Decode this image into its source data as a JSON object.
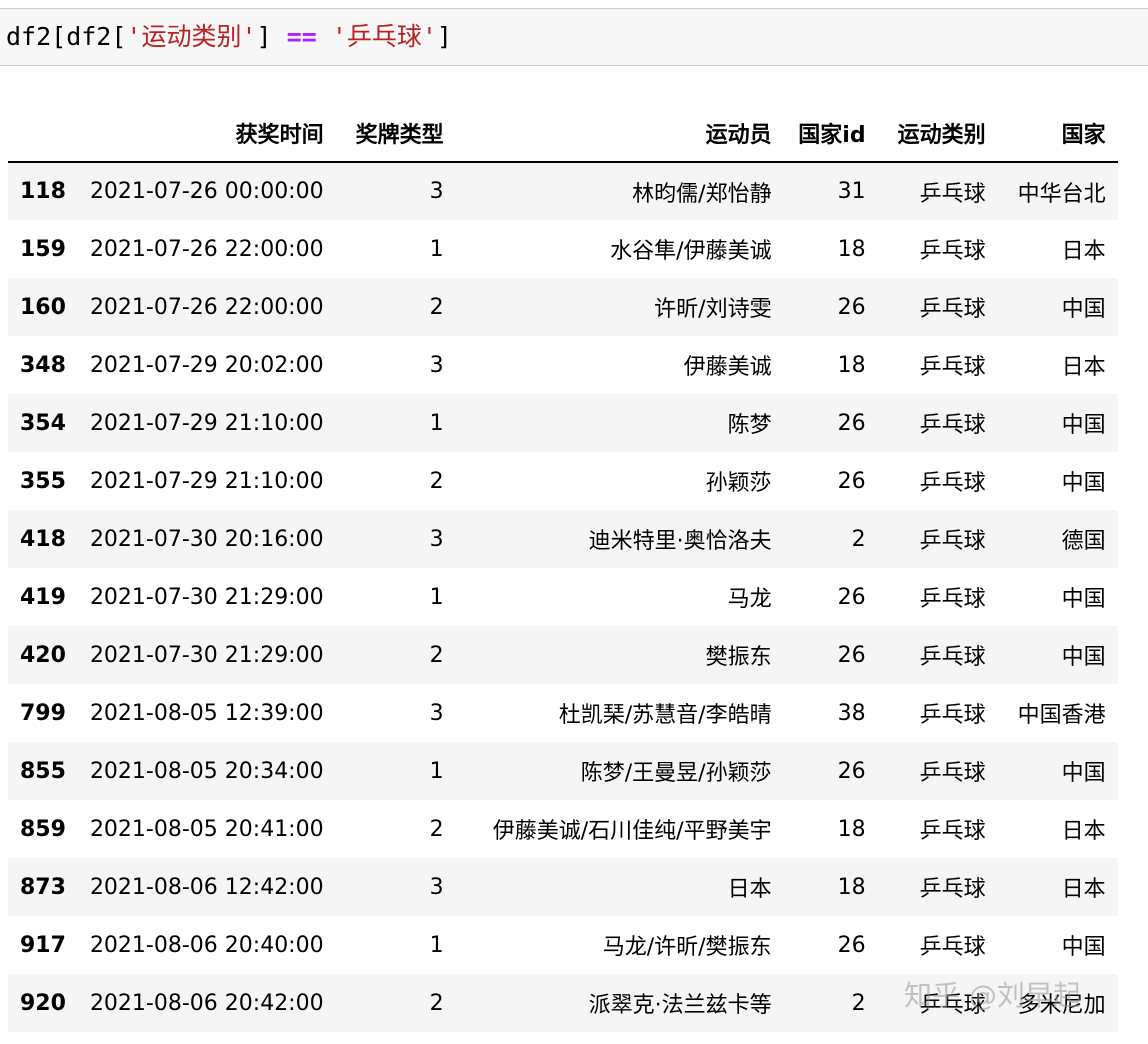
{
  "code_cell": {
    "prefix": "df2[df2[",
    "str1": "'运动类别'",
    "mid": "] ",
    "op": "==",
    "space": " ",
    "str2": "'乒乓球'",
    "suffix": "]"
  },
  "table": {
    "columns": [
      "",
      "获奖时间",
      "奖牌类型",
      "运动员",
      "国家id",
      "运动类别",
      "国家"
    ],
    "rows": [
      {
        "index": "118",
        "time": "2021-07-26 00:00:00",
        "medal": "3",
        "athlete": "林昀儒/郑怡静",
        "country_id": "31",
        "sport": "乒乓球",
        "country": "中华台北"
      },
      {
        "index": "159",
        "time": "2021-07-26 22:00:00",
        "medal": "1",
        "athlete": "水谷隼/伊藤美诚",
        "country_id": "18",
        "sport": "乒乓球",
        "country": "日本"
      },
      {
        "index": "160",
        "time": "2021-07-26 22:00:00",
        "medal": "2",
        "athlete": "许昕/刘诗雯",
        "country_id": "26",
        "sport": "乒乓球",
        "country": "中国"
      },
      {
        "index": "348",
        "time": "2021-07-29 20:02:00",
        "medal": "3",
        "athlete": "伊藤美诚",
        "country_id": "18",
        "sport": "乒乓球",
        "country": "日本"
      },
      {
        "index": "354",
        "time": "2021-07-29 21:10:00",
        "medal": "1",
        "athlete": "陈梦",
        "country_id": "26",
        "sport": "乒乓球",
        "country": "中国"
      },
      {
        "index": "355",
        "time": "2021-07-29 21:10:00",
        "medal": "2",
        "athlete": "孙颖莎",
        "country_id": "26",
        "sport": "乒乓球",
        "country": "中国"
      },
      {
        "index": "418",
        "time": "2021-07-30 20:16:00",
        "medal": "3",
        "athlete": "迪米特里·奥恰洛夫",
        "country_id": "2",
        "sport": "乒乓球",
        "country": "德国"
      },
      {
        "index": "419",
        "time": "2021-07-30 21:29:00",
        "medal": "1",
        "athlete": "马龙",
        "country_id": "26",
        "sport": "乒乓球",
        "country": "中国"
      },
      {
        "index": "420",
        "time": "2021-07-30 21:29:00",
        "medal": "2",
        "athlete": "樊振东",
        "country_id": "26",
        "sport": "乒乓球",
        "country": "中国"
      },
      {
        "index": "799",
        "time": "2021-08-05 12:39:00",
        "medal": "3",
        "athlete": "杜凯琹/苏慧音/李皓晴",
        "country_id": "38",
        "sport": "乒乓球",
        "country": "中国香港"
      },
      {
        "index": "855",
        "time": "2021-08-05 20:34:00",
        "medal": "1",
        "athlete": "陈梦/王曼昱/孙颖莎",
        "country_id": "26",
        "sport": "乒乓球",
        "country": "中国"
      },
      {
        "index": "859",
        "time": "2021-08-05 20:41:00",
        "medal": "2",
        "athlete": "伊藤美诚/石川佳纯/平野美宇",
        "country_id": "18",
        "sport": "乒乓球",
        "country": "日本"
      },
      {
        "index": "873",
        "time": "2021-08-06 12:42:00",
        "medal": "3",
        "athlete": "日本",
        "country_id": "18",
        "sport": "乒乓球",
        "country": "日本"
      },
      {
        "index": "917",
        "time": "2021-08-06 20:40:00",
        "medal": "1",
        "athlete": "马龙/许昕/樊振东",
        "country_id": "26",
        "sport": "乒乓球",
        "country": "中国"
      },
      {
        "index": "920",
        "time": "2021-08-06 20:42:00",
        "medal": "2",
        "athlete": "派翠克·法兰兹卡等",
        "country_id": "2",
        "sport": "乒乓球",
        "country": "多米尼加"
      }
    ]
  },
  "watermark": "知乎 @刘早起"
}
